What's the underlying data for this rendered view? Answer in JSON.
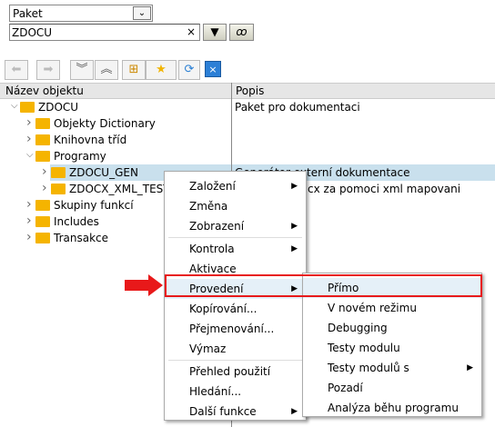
{
  "selector": {
    "value": "Paket"
  },
  "search": {
    "value": "ZDOCU",
    "clear": "×"
  },
  "toolbar": {
    "icons": [
      "back-icon",
      "forward-icon",
      "expand-all-icon",
      "collapse-all-icon",
      "hierarchy-icon",
      "favorites-star-icon",
      "refresh-icon",
      "close-window-icon"
    ]
  },
  "columns": {
    "name": "Název objektu",
    "desc": "Popis"
  },
  "tree": [
    {
      "label": "ZDOCU",
      "desc": "Paket pro dokumentaci"
    },
    {
      "label": "Objekty Dictionary"
    },
    {
      "label": "Knihovna tříd"
    },
    {
      "label": "Programy"
    },
    {
      "label": "ZDOCU_GEN",
      "desc": "Generátor externí dokumentace"
    },
    {
      "label": "ZDOCX_XML_TEST",
      "desc": "cx za pomoci xml mapovani"
    },
    {
      "label": "Skupiny funkcí"
    },
    {
      "label": "Includes"
    },
    {
      "label": "Transakce"
    }
  ],
  "context_menu": [
    {
      "label": "Založení",
      "sub": true
    },
    {
      "label": "Změna"
    },
    {
      "label": "Zobrazení",
      "sub": true
    },
    {
      "label": "Kontrola",
      "sub": true
    },
    {
      "label": "Aktivace"
    },
    {
      "label": "Provedení",
      "sub": true,
      "active": true
    },
    {
      "label": "Kopírování..."
    },
    {
      "label": "Přejmenování..."
    },
    {
      "label": "Výmaz"
    },
    {
      "label": "Přehled použití"
    },
    {
      "label": "Hledání..."
    },
    {
      "label": "Další funkce",
      "sub": true
    }
  ],
  "submenu": [
    {
      "label": "Přímo",
      "active": true
    },
    {
      "label": "V novém režimu"
    },
    {
      "label": "Debugging"
    },
    {
      "label": "Testy modulu"
    },
    {
      "label": "Testy modulů s",
      "sub": true
    },
    {
      "label": "Pozadí"
    },
    {
      "label": "Analýza běhu programu"
    }
  ],
  "colors": {
    "highlight": "#c9e0ed",
    "callout": "#e8191a",
    "folder": "#f5b400"
  }
}
